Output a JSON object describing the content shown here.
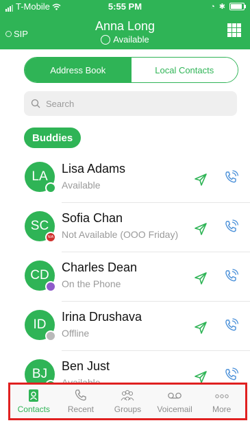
{
  "status_bar": {
    "carrier": "T-Mobile",
    "time": "5:55 PM"
  },
  "header": {
    "sip_label": "SIP",
    "user_name": "Anna Long",
    "user_status": "Available",
    "grid_icon": "dialpad-grid-icon"
  },
  "segments": {
    "address_book": "Address Book",
    "local_contacts": "Local Contacts",
    "selected": "Address Book"
  },
  "search": {
    "placeholder": "Search"
  },
  "group": {
    "label": "Buddies"
  },
  "contacts": [
    {
      "initials": "LA",
      "name": "Lisa Adams",
      "status": "Available",
      "presence": "available",
      "presence_color": "#2fb456",
      "presence_badge": ""
    },
    {
      "initials": "SC",
      "name": "Sofia Chan",
      "status": "Not Available (OOO Friday)",
      "presence": "not-available",
      "presence_color": "#d0312d",
      "presence_badge": "N/A"
    },
    {
      "initials": "CD",
      "name": "Charles Dean",
      "status": "On the Phone",
      "presence": "on-phone",
      "presence_color": "#8e5bc9",
      "presence_badge": ""
    },
    {
      "initials": "ID",
      "name": "Irina Drushava",
      "status": "Offline",
      "presence": "offline",
      "presence_color": "#b9b9b9",
      "presence_badge": ""
    },
    {
      "initials": "BJ",
      "name": "Ben Just",
      "status": "Available",
      "presence": "available",
      "presence_color": "#2fb456",
      "presence_badge": ""
    }
  ],
  "tabs": [
    {
      "label": "Contacts",
      "icon": "contacts-icon",
      "active": true
    },
    {
      "label": "Recent",
      "icon": "phone-recent-icon",
      "active": false
    },
    {
      "label": "Groups",
      "icon": "groups-icon",
      "active": false
    },
    {
      "label": "Voicemail",
      "icon": "voicemail-icon",
      "active": false
    },
    {
      "label": "More",
      "icon": "more-icon",
      "active": false
    }
  ],
  "colors": {
    "brand": "#2fb456",
    "highlight_border": "#e02020"
  }
}
